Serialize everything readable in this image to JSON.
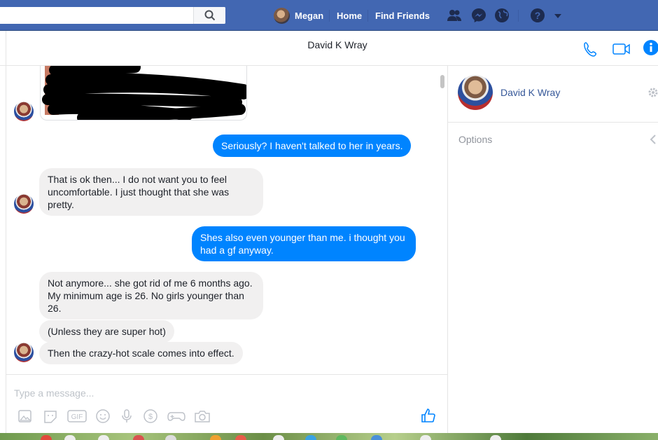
{
  "nav": {
    "user_name": "Megan",
    "home_label": "Home",
    "find_friends_label": "Find Friends"
  },
  "conversation": {
    "title": "David K Wray"
  },
  "messages": [
    {
      "dir": "out",
      "text": "Seriously?  I haven't talked to her in years."
    },
    {
      "dir": "in",
      "text": "That is ok then... I do not want you to feel uncomfortable. I just thought that she was pretty."
    },
    {
      "dir": "out",
      "text": "Shes also even younger than me.  i thought you had a gf anyway."
    },
    {
      "dir": "in",
      "text": "Not anymore... she got rid of me 6 months ago. My minimum age is 26. No girls younger than 26."
    },
    {
      "dir": "in",
      "text": "(Unless they are super hot)"
    },
    {
      "dir": "in",
      "text": "Then the crazy-hot scale comes into effect."
    }
  ],
  "composer": {
    "placeholder": "Type a message...",
    "gif_label": "GIF"
  },
  "side_panel": {
    "name": "David K Wray",
    "options_label": "Options"
  },
  "colors": {
    "nav_blue": "#4267b2",
    "outgoing_bubble": "#0084ff",
    "incoming_bubble": "#f1f0f0",
    "link_blue": "#365899"
  }
}
